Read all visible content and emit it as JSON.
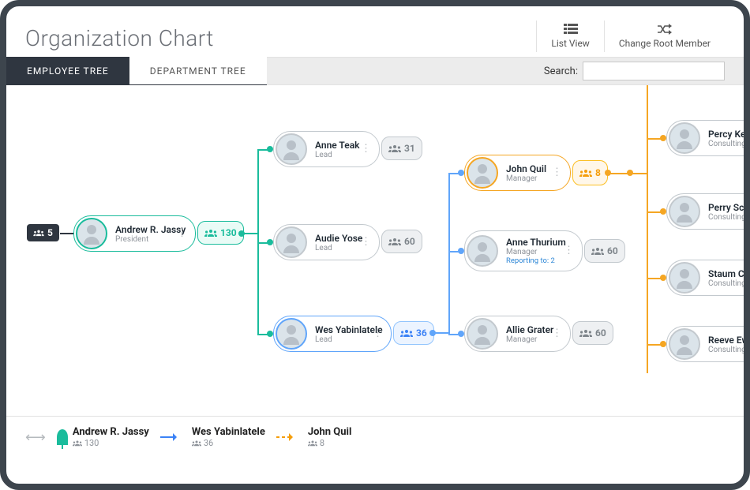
{
  "header": {
    "title": "Organization Chart",
    "list_view_label": "List View",
    "change_root_label": "Change Root Member"
  },
  "tabs": {
    "employee_tree": "EMPLOYEE TREE",
    "department_tree": "DEPARTMENT TREE"
  },
  "search": {
    "label": "Search:",
    "value": ""
  },
  "root_collapse_count": "5",
  "nodes": {
    "andrew": {
      "name": "Andrew R. Jassy",
      "role": "President",
      "count": "130"
    },
    "anne_teak": {
      "name": "Anne Teak",
      "role": "Lead",
      "count": "31"
    },
    "audie": {
      "name": "Audie Yose",
      "role": "Lead",
      "count": "60"
    },
    "wes": {
      "name": "Wes Yabinlatele",
      "role": "Lead",
      "count": "36"
    },
    "john": {
      "name": "John Quil",
      "role": "Manager",
      "count": "8"
    },
    "anne_th": {
      "name": "Anne Thurium",
      "role": "Manager",
      "reporting": "Reporting to: 2",
      "count": "60"
    },
    "allie": {
      "name": "Allie Grater",
      "role": "Manager",
      "count": "60"
    },
    "percy": {
      "name": "Percy Kew",
      "role": "Consulting"
    },
    "perry": {
      "name": "Perry Scop",
      "role": "Consulting"
    },
    "staum": {
      "name": "Staum Cl",
      "role": "Consulting"
    },
    "reeve": {
      "name": "Reeve Ewe",
      "role": "Consulting"
    }
  },
  "breadcrumb": {
    "a": {
      "name": "Andrew R. Jassy",
      "count": "130"
    },
    "b": {
      "name": "Wes Yabinlatele",
      "count": "36"
    },
    "c": {
      "name": "John Quil",
      "count": "8"
    }
  }
}
